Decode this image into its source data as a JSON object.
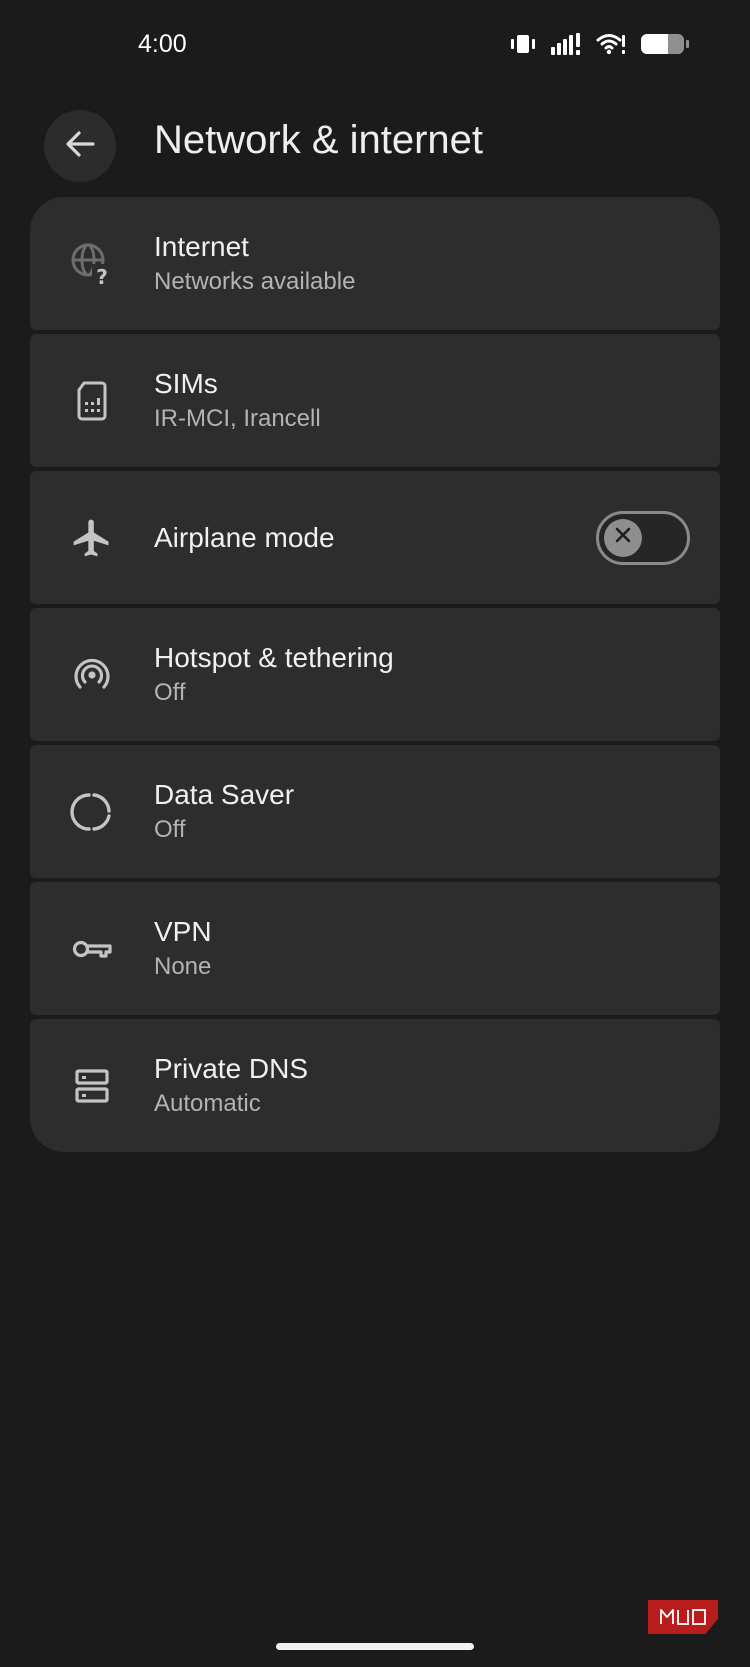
{
  "status_bar": {
    "time": "4:00",
    "icons": [
      "vibrate-icon",
      "cellular-signal-icon",
      "wifi-icon",
      "battery-icon"
    ]
  },
  "header": {
    "back_icon": "arrow-back-icon",
    "title": "Network & internet"
  },
  "settings": [
    {
      "icon": "globe-question-icon",
      "title": "Internet",
      "subtitle": "Networks available"
    },
    {
      "icon": "sim-card-icon",
      "title": "SIMs",
      "subtitle": "IR-MCI, Irancell"
    },
    {
      "icon": "airplane-icon",
      "title": "Airplane mode",
      "toggle": false
    },
    {
      "icon": "hotspot-icon",
      "title": "Hotspot & tethering",
      "subtitle": "Off"
    },
    {
      "icon": "data-saver-icon",
      "title": "Data Saver",
      "subtitle": "Off"
    },
    {
      "icon": "vpn-key-icon",
      "title": "VPN",
      "subtitle": "None"
    },
    {
      "icon": "dns-server-icon",
      "title": "Private DNS",
      "subtitle": "Automatic"
    }
  ],
  "watermark": {
    "text": "MUO",
    "color": "#b81d1d"
  },
  "colors": {
    "background": "#1b1b1b",
    "card": "#2d2d2d",
    "primary_text": "#f0f0f0",
    "secondary_text": "#b3b3b3",
    "icon": "#c4c4c4"
  }
}
